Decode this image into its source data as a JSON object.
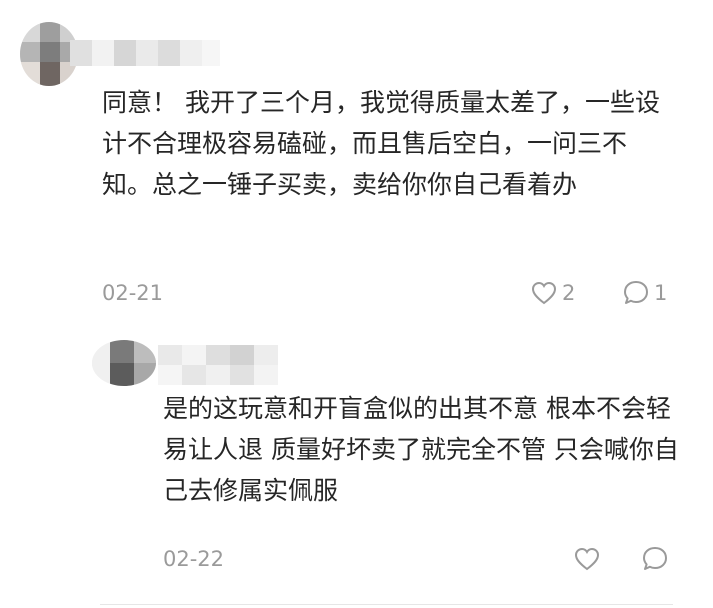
{
  "comments": [
    {
      "text": "同意！ 我开了三个月，我觉得质量太差了，一些设计不合理极容易磕碰，而且售后空白，一问三不知。总之一锤子买卖，卖给你你自己看着办",
      "date": "02-21",
      "like_count": "2",
      "reply_count": "1",
      "like_icon": "heart-outline-icon",
      "reply_icon": "speech-bubble-icon"
    },
    {
      "text": "是的这玩意和开盲盒似的出其不意 根本不会轻易让人退 质量好坏卖了就完全不管 只会喊你自己去修属实佩服",
      "date": "02-22",
      "like_count": "",
      "reply_count": "",
      "like_icon": "heart-outline-icon",
      "reply_icon": "speech-bubble-icon"
    }
  ],
  "colors": {
    "text": "#262626",
    "meta": "#9a9a9a",
    "divider": "#e6e6e6",
    "blur_light": "#ebebeb",
    "blur_mid": "#b9b9b9",
    "blur_dark": "#6e6e6e"
  }
}
